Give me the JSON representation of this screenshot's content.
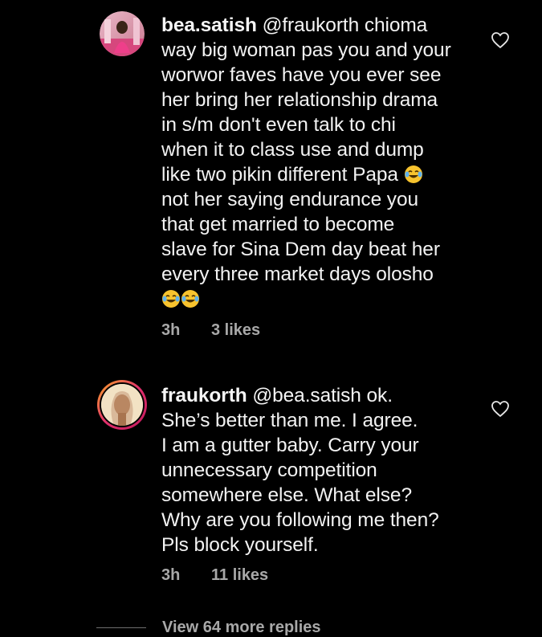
{
  "comments": [
    {
      "username": "bea.satish",
      "mention": "@fraukorth",
      "lines": [
        " chioma",
        "way big woman pas you and your",
        "worwor faves have you ever see",
        "her bring her relationship drama",
        "in s/m don't even talk to chi",
        "when it to class use and dump",
        "like two pikin different Papa "
      ],
      "lines_after_emoji": [
        "not her saying endurance you",
        "that get married to become",
        "slave for Sina Dem day beat her",
        "every three market days olosho"
      ],
      "emoji_icon": "face-with-tears-of-joy-icon",
      "time": "3h",
      "likes": "3 likes"
    },
    {
      "username": "fraukorth",
      "mention": "@bea.satish",
      "lines": [
        " ok.",
        "She’s better than me. I agree.",
        "I am a gutter baby. Carry your",
        "unnecessary competition",
        "somewhere else. What else?",
        "Why are you following me then?",
        "Pls block yourself."
      ],
      "time": "3h",
      "likes": "11 likes"
    }
  ],
  "view_replies": "View 64 more replies",
  "icons": {
    "like": "heart-outline-icon"
  },
  "colors": {
    "background": "#000000",
    "text": "#f2f2f2",
    "meta": "#a8a8a8",
    "story_ring_start": "#f9a825",
    "story_ring_end": "#c2185b"
  }
}
